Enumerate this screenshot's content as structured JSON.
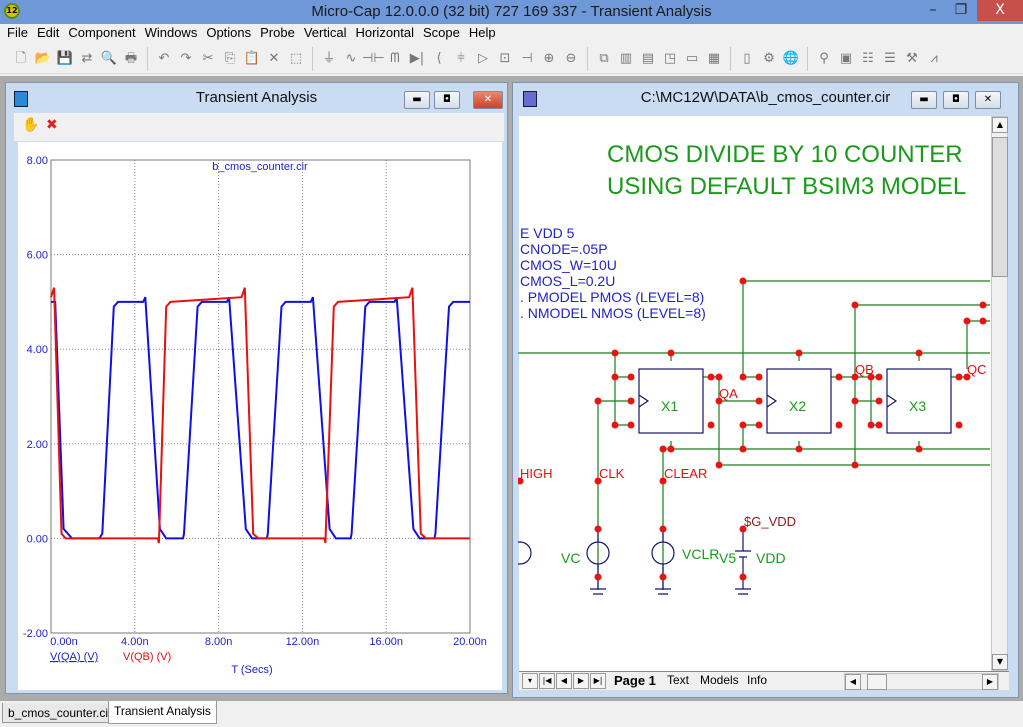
{
  "app": {
    "title": "Micro-Cap 12.0.0.0 (32 bit) 727 169 337 - Transient Analysis",
    "icon_label": "12",
    "minimize": "–",
    "restore": "❐",
    "close": "X"
  },
  "menu": [
    "File",
    "Edit",
    "Component",
    "Windows",
    "Options",
    "Probe",
    "Vertical",
    "Horizontal",
    "Scope",
    "Help"
  ],
  "toolbar": {
    "groups": [
      [
        {
          "icon": "new-file-icon",
          "glyph": "🗋"
        },
        {
          "icon": "open-folder-icon",
          "glyph": "📂"
        },
        {
          "icon": "save-icon",
          "glyph": "💾"
        },
        {
          "icon": "translate-icon",
          "glyph": "⇄"
        },
        {
          "icon": "print-preview-icon",
          "glyph": "🔍"
        },
        {
          "icon": "print-icon",
          "glyph": "🖶"
        }
      ],
      [
        {
          "icon": "undo-icon",
          "glyph": "↶"
        },
        {
          "icon": "redo-icon",
          "glyph": "↷"
        },
        {
          "icon": "cut-icon",
          "glyph": "✂"
        },
        {
          "icon": "copy-icon",
          "glyph": "⎘"
        },
        {
          "icon": "paste-icon",
          "glyph": "📋"
        },
        {
          "icon": "delete-icon",
          "glyph": "✕"
        },
        {
          "icon": "select-all-icon",
          "glyph": "⬚"
        }
      ],
      [
        {
          "icon": "ground-icon",
          "glyph": "⏚"
        },
        {
          "icon": "resistor-icon",
          "glyph": "∿"
        },
        {
          "icon": "capacitor-icon",
          "glyph": "⊣⊢"
        },
        {
          "icon": "inductor-icon",
          "glyph": "ᗰ"
        },
        {
          "icon": "diode-icon",
          "glyph": "▶|"
        },
        {
          "icon": "transistor-icon",
          "glyph": "⟨"
        },
        {
          "icon": "mosfet-icon",
          "glyph": "⫩"
        },
        {
          "icon": "opamp-icon",
          "glyph": "▷"
        },
        {
          "icon": "macro-icon",
          "glyph": "⊡"
        },
        {
          "icon": "battery-icon",
          "glyph": "⊣"
        },
        {
          "icon": "current-source-icon",
          "glyph": "⊕"
        },
        {
          "icon": "voltage-source-icon",
          "glyph": "⊖"
        }
      ],
      [
        {
          "icon": "cascade-icon",
          "glyph": "⧉"
        },
        {
          "icon": "tile-vertical-icon",
          "glyph": "▥"
        },
        {
          "icon": "tile-horizontal-icon",
          "glyph": "▤"
        },
        {
          "icon": "split-icon",
          "glyph": "◳"
        },
        {
          "icon": "window-icon",
          "glyph": "▭"
        },
        {
          "icon": "calculator-icon",
          "glyph": "▦"
        }
      ],
      [
        {
          "icon": "components-icon",
          "glyph": "▯"
        },
        {
          "icon": "settings-icon",
          "glyph": "⚙"
        },
        {
          "icon": "globe-icon",
          "glyph": "🌐"
        }
      ],
      [
        {
          "icon": "probe-icon",
          "glyph": "⚲"
        },
        {
          "icon": "window2-icon",
          "glyph": "▣"
        },
        {
          "icon": "properties-icon",
          "glyph": "☷"
        },
        {
          "icon": "list-icon",
          "glyph": "☰"
        },
        {
          "icon": "tools-icon",
          "glyph": "⚒"
        },
        {
          "icon": "analysis-icon",
          "glyph": "⩘"
        }
      ]
    ]
  },
  "plot_window": {
    "title": "Transient Analysis",
    "tools": [
      {
        "icon": "hand-icon",
        "glyph": "✋"
      },
      {
        "icon": "remove-plot-icon",
        "glyph": "✖"
      }
    ]
  },
  "chart_data": {
    "type": "line",
    "title": "b_cmos_counter.cir",
    "xlabel": "T (Secs)",
    "xlim": [
      0,
      20
    ],
    "ylim": [
      -2,
      8
    ],
    "x_ticks": [
      "0.00n",
      "4.00n",
      "8.00n",
      "12.00n",
      "16.00n",
      "20.00n"
    ],
    "x_tick_values": [
      0,
      4,
      8,
      12,
      16,
      20
    ],
    "y_ticks": [
      "8.00",
      "6.00",
      "4.00",
      "2.00",
      "0.00",
      "-2.00"
    ],
    "y_tick_values": [
      8,
      6,
      4,
      2,
      0,
      -2
    ],
    "grid": true,
    "series": [
      {
        "name": "V(QA) (V)",
        "color": "#1010e0",
        "points": [
          [
            0,
            5
          ],
          [
            0.2,
            5
          ],
          [
            0.6,
            0.2
          ],
          [
            1,
            0
          ],
          [
            2.3,
            0
          ],
          [
            2.45,
            0.1
          ],
          [
            3.0,
            4.9
          ],
          [
            3.2,
            5
          ],
          [
            4.4,
            5
          ],
          [
            4.5,
            5.1
          ],
          [
            5.2,
            0.2
          ],
          [
            5.5,
            0
          ],
          [
            6.3,
            0
          ],
          [
            6.35,
            0.1
          ],
          [
            7.0,
            4.9
          ],
          [
            7.2,
            5
          ],
          [
            8.4,
            5
          ],
          [
            8.5,
            5.1
          ],
          [
            9.3,
            0.2
          ],
          [
            9.6,
            0
          ],
          [
            10.3,
            0
          ],
          [
            10.35,
            0.1
          ],
          [
            11.0,
            4.9
          ],
          [
            11.2,
            5
          ],
          [
            12.4,
            5
          ],
          [
            12.5,
            5.1
          ],
          [
            13.3,
            0.2
          ],
          [
            13.6,
            0
          ],
          [
            14.3,
            0
          ],
          [
            14.35,
            0.1
          ],
          [
            15.0,
            4.9
          ],
          [
            15.2,
            5
          ],
          [
            16.4,
            5
          ],
          [
            16.5,
            5.1
          ],
          [
            17.3,
            0.2
          ],
          [
            17.6,
            0
          ],
          [
            18.3,
            0
          ],
          [
            18.35,
            0.1
          ],
          [
            19.0,
            4.9
          ],
          [
            19.2,
            5
          ],
          [
            20,
            5
          ]
        ]
      },
      {
        "name": "V(QB) (V)",
        "color": "#e81010",
        "points": [
          [
            0,
            5.1
          ],
          [
            0.15,
            5.3
          ],
          [
            0.5,
            0.1
          ],
          [
            0.7,
            0
          ],
          [
            5.1,
            0
          ],
          [
            5.15,
            -0.1
          ],
          [
            5.5,
            4.9
          ],
          [
            5.7,
            5
          ],
          [
            9.1,
            5.1
          ],
          [
            9.25,
            5.3
          ],
          [
            9.65,
            0.1
          ],
          [
            9.9,
            0
          ],
          [
            13.05,
            0
          ],
          [
            13.1,
            -0.1
          ],
          [
            13.5,
            4.9
          ],
          [
            13.7,
            5
          ],
          [
            17.1,
            5.1
          ],
          [
            17.25,
            5.3
          ],
          [
            17.65,
            0.1
          ],
          [
            17.9,
            0
          ],
          [
            20,
            0
          ]
        ]
      }
    ]
  },
  "schematic_window": {
    "title": "C:\\MC12W\\DATA\\b_cmos_counter.cir",
    "heading": [
      "CMOS DIVIDE BY 10 COUNTER",
      "USING DEFAULT BSIM3 MODEL"
    ],
    "text_lines": [
      "E VDD 5",
      " CNODE=.05P",
      " CMOS_W=10U",
      " CMOS_L=0.2U",
      ". PMODEL PMOS (LEVEL=8)",
      ". NMODEL NMOS (LEVEL=8)"
    ],
    "parts": [
      "X1",
      "X2",
      "X3"
    ],
    "nodes": [
      "QA",
      "QB",
      "QC",
      "HIGH",
      "CLK",
      "CLEAR",
      "$G_VDD"
    ],
    "sources": [
      "VC",
      "VCLR",
      "V5",
      "VDD"
    ],
    "page_tabs": [
      "Page 1",
      "Text",
      "Models",
      "Info"
    ],
    "colors": {
      "wire": "#1f7a1f",
      "node": "#ee1111",
      "part": "#14146e",
      "text": "#2222cc",
      "heading": "#1a9a1a"
    }
  },
  "bottom_tabs": [
    "b_cmos_counter.cir",
    "Transient Analysis"
  ]
}
